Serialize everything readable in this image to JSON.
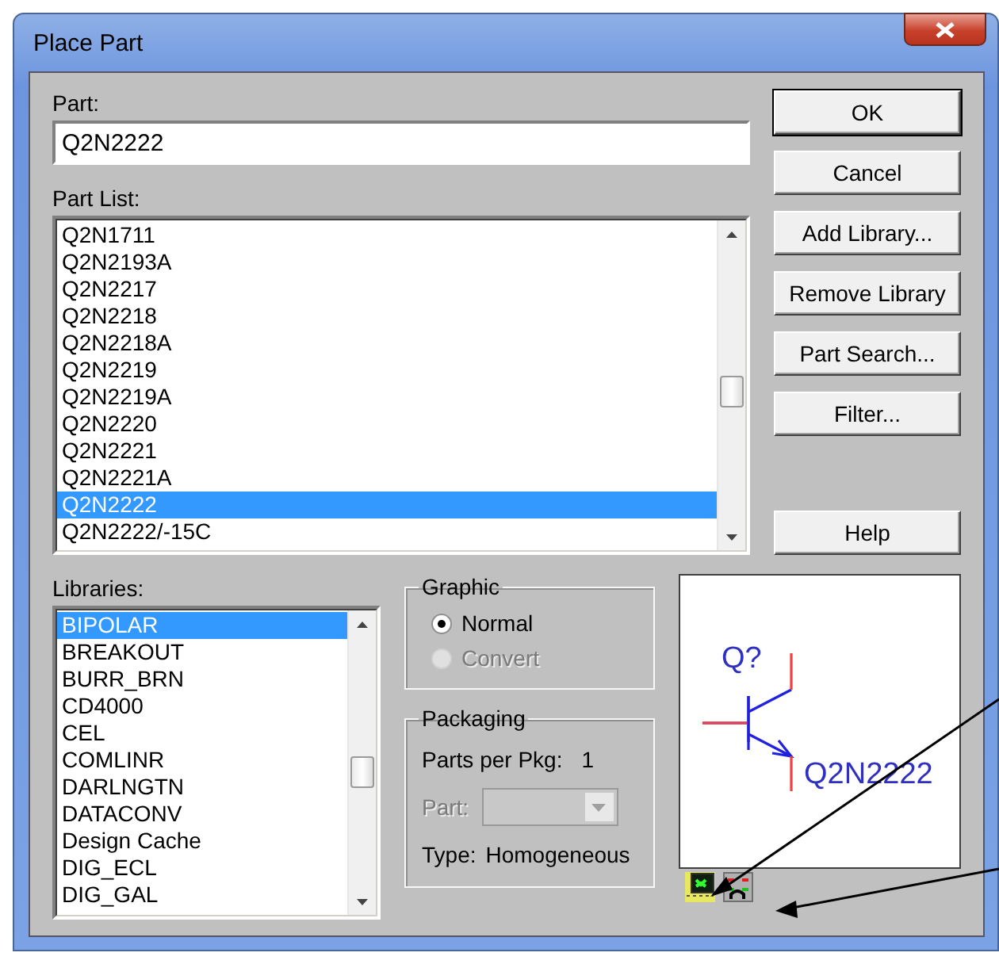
{
  "window": {
    "title": "Place Part"
  },
  "part": {
    "label": "Part:",
    "value": "Q2N2222"
  },
  "part_list": {
    "label": "Part List:",
    "items": [
      {
        "text": "Q2N1711",
        "selected": false
      },
      {
        "text": "Q2N2193A",
        "selected": false
      },
      {
        "text": "Q2N2217",
        "selected": false
      },
      {
        "text": "Q2N2218",
        "selected": false
      },
      {
        "text": "Q2N2218A",
        "selected": false
      },
      {
        "text": "Q2N2219",
        "selected": false
      },
      {
        "text": "Q2N2219A",
        "selected": false
      },
      {
        "text": "Q2N2220",
        "selected": false
      },
      {
        "text": "Q2N2221",
        "selected": false
      },
      {
        "text": "Q2N2221A",
        "selected": false
      },
      {
        "text": "Q2N2222",
        "selected": true
      },
      {
        "text": "Q2N2222/-15C",
        "selected": false
      }
    ]
  },
  "buttons": [
    {
      "label": "OK",
      "default": true
    },
    {
      "label": "Cancel",
      "default": false
    },
    {
      "label": "Add Library...",
      "default": false
    },
    {
      "label": "Remove Library",
      "default": false
    },
    {
      "label": "Part Search...",
      "default": false
    },
    {
      "label": "Filter...",
      "default": false
    }
  ],
  "help_button": {
    "label": "Help"
  },
  "libraries": {
    "label": "Libraries:",
    "items": [
      {
        "text": "BIPOLAR",
        "selected": true
      },
      {
        "text": "BREAKOUT",
        "selected": false
      },
      {
        "text": "BURR_BRN",
        "selected": false
      },
      {
        "text": "CD4000",
        "selected": false
      },
      {
        "text": "CEL",
        "selected": false
      },
      {
        "text": "COMLINR",
        "selected": false
      },
      {
        "text": "DARLNGTN",
        "selected": false
      },
      {
        "text": "DATACONV",
        "selected": false
      },
      {
        "text": "Design Cache",
        "selected": false
      },
      {
        "text": "DIG_ECL",
        "selected": false
      },
      {
        "text": "DIG_GAL",
        "selected": false
      }
    ]
  },
  "graphic": {
    "title": "Graphic",
    "options": [
      {
        "label": "Normal",
        "selected": true,
        "disabled": false
      },
      {
        "label": "Convert",
        "selected": false,
        "disabled": true
      }
    ]
  },
  "packaging": {
    "title": "Packaging",
    "parts_per_pkg_label": "Parts per Pkg:",
    "parts_per_pkg_value": "1",
    "part_label": "Part:",
    "part_disabled": true,
    "type_label": "Type:",
    "type_value": "Homogeneous"
  },
  "preview": {
    "reference": "Q?",
    "value": "Q2N2222"
  }
}
